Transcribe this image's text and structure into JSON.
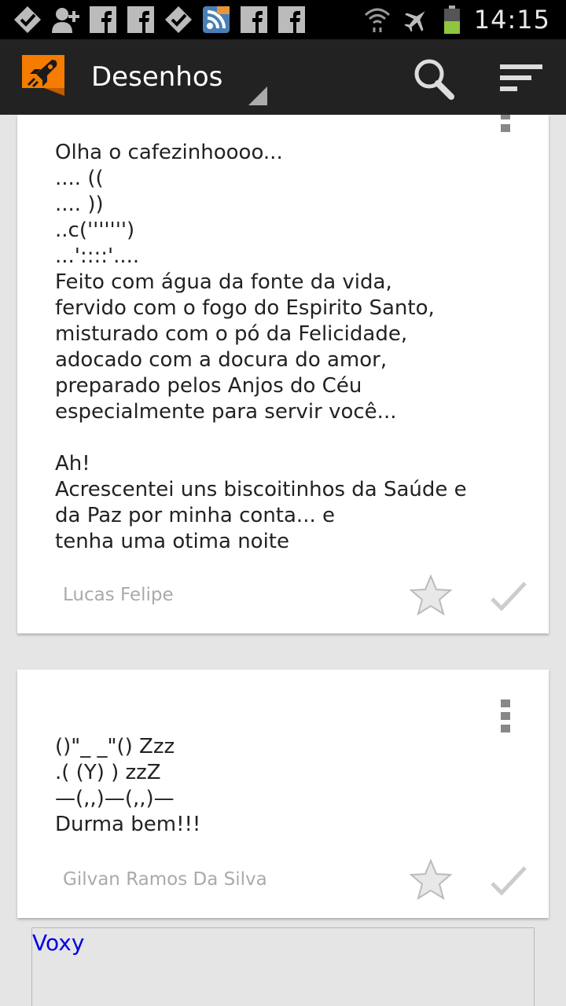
{
  "status_bar": {
    "time": "14:15",
    "notification_icons": [
      "check-badge-icon",
      "add-contact-icon",
      "facebook-icon",
      "facebook-icon",
      "check-badge-icon",
      "rss-icon",
      "facebook-icon",
      "facebook-icon"
    ],
    "system_icons": [
      "wifi-icon",
      "airplane-icon",
      "battery-icon"
    ]
  },
  "action_bar": {
    "title": "Desenhos",
    "accent": "#f57c00"
  },
  "cards": [
    {
      "text": "Olha o cafezinhoooo...\n.... ((\n.... ))\n..c(''''''')\n...'::::'....\nFeito com água da fonte da vida,\nfervido com o fogo do Espirito Santo,\nmisturado com o pó da Felicidade,\nadocado com a docura do amor,\npreparado pelos Anjos do Céu\nespecialmente para servir você...\n\nAh!\nAcrescentei uns biscoitinhos da Saúde e\nda Paz por minha conta... e\ntenha uma otima noite",
      "author": "Lucas Felipe"
    },
    {
      "text": "()\"_ _\"() Zzz\n.( (Y) ) zzZ\n—(,,)—(,,)—\nDurma bem!!!",
      "author": "Gilvan Ramos Da Silva"
    }
  ],
  "ad": {
    "label": "Voxy"
  }
}
